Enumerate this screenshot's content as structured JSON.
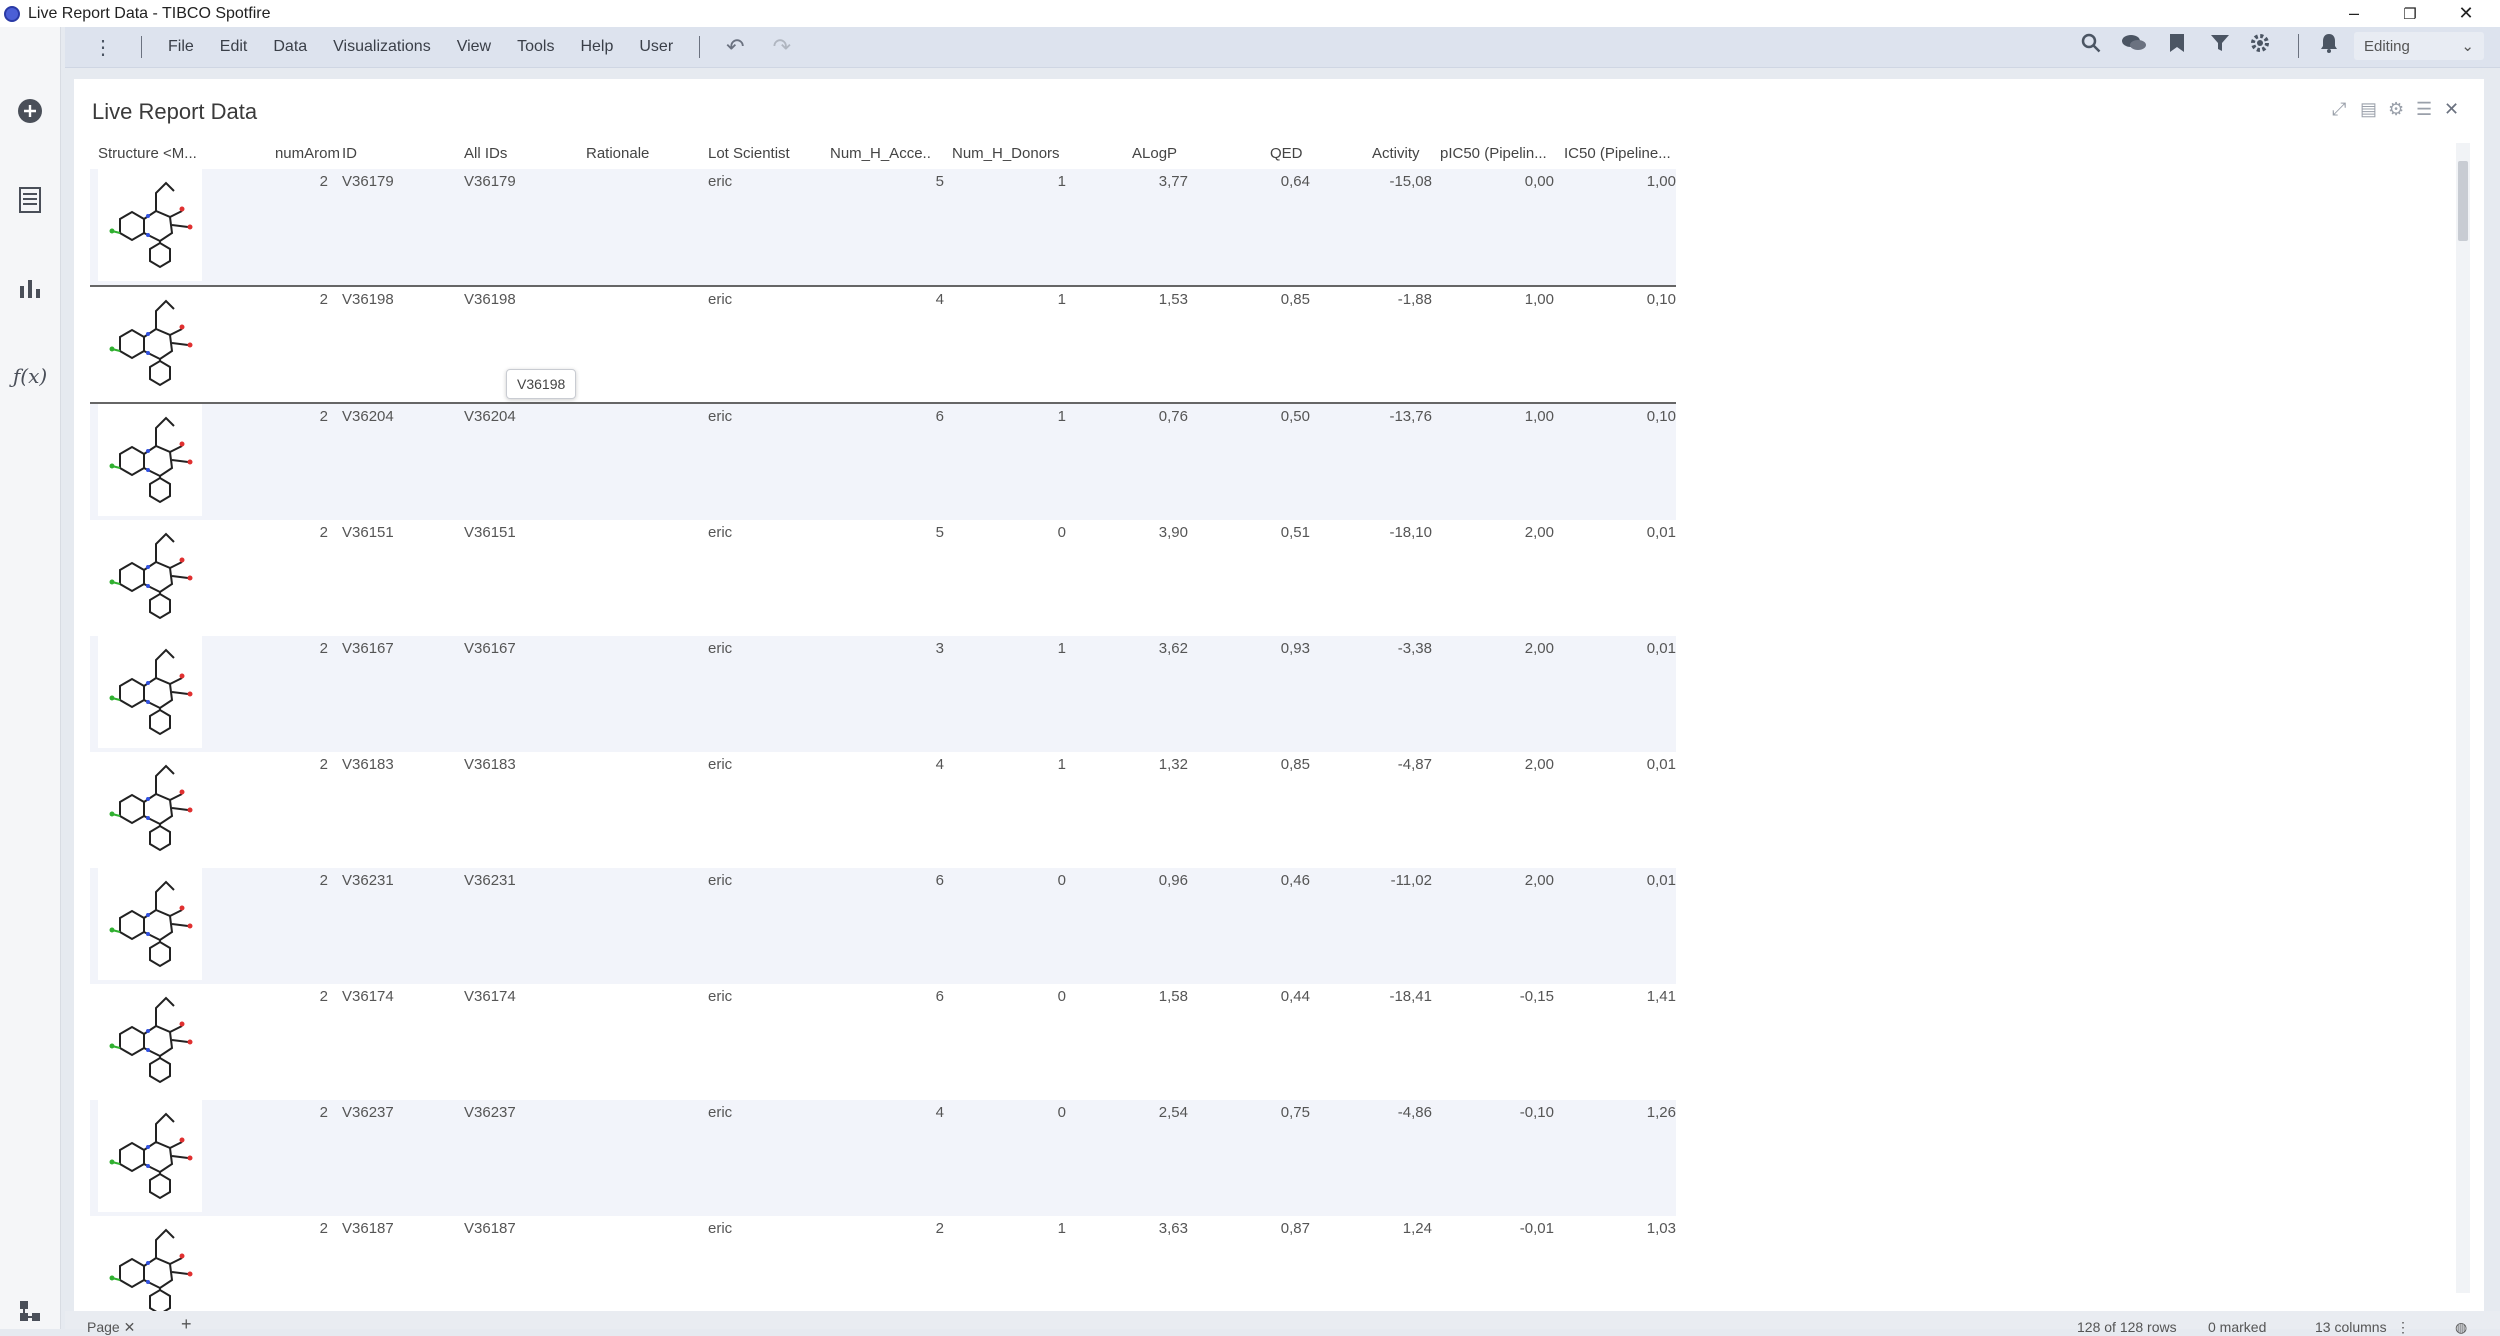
{
  "window": {
    "title": "Live Report Data - TIBCO Spotfire",
    "minimize": "–",
    "restore": "❐",
    "close": "✕"
  },
  "menubar": {
    "items": [
      "File",
      "Edit",
      "Data",
      "Visualizations",
      "View",
      "Tools",
      "Help",
      "User"
    ],
    "mode": "Editing"
  },
  "panel": {
    "title": "Live Report Data"
  },
  "table": {
    "columns": [
      "Structure <M...",
      "numArom",
      "ID",
      "All IDs",
      "Rationale",
      "Lot Scientist",
      "Num_H_Acce...",
      "Num_H_Donors",
      "ALogP",
      "QED",
      "Activity",
      "pIC50 (Pipelin...",
      "IC50 (Pipeline..."
    ],
    "rows": [
      {
        "numArom": "2",
        "id": "V36179",
        "all_ids": "V36179",
        "rationale": "",
        "lot_scientist": "eric",
        "acc": "5",
        "don": "1",
        "alogp": "3,77",
        "qed": "0,64",
        "activity": "-15,08",
        "pic50": "0,00",
        "ic50": "1,00"
      },
      {
        "numArom": "2",
        "id": "V36198",
        "all_ids": "V36198",
        "rationale": "",
        "lot_scientist": "eric",
        "acc": "4",
        "don": "1",
        "alogp": "1,53",
        "qed": "0,85",
        "activity": "-1,88",
        "pic50": "1,00",
        "ic50": "0,10"
      },
      {
        "numArom": "2",
        "id": "V36204",
        "all_ids": "V36204",
        "rationale": "",
        "lot_scientist": "eric",
        "acc": "6",
        "don": "1",
        "alogp": "0,76",
        "qed": "0,50",
        "activity": "-13,76",
        "pic50": "1,00",
        "ic50": "0,10"
      },
      {
        "numArom": "2",
        "id": "V36151",
        "all_ids": "V36151",
        "rationale": "",
        "lot_scientist": "eric",
        "acc": "5",
        "don": "0",
        "alogp": "3,90",
        "qed": "0,51",
        "activity": "-18,10",
        "pic50": "2,00",
        "ic50": "0,01"
      },
      {
        "numArom": "2",
        "id": "V36167",
        "all_ids": "V36167",
        "rationale": "",
        "lot_scientist": "eric",
        "acc": "3",
        "don": "1",
        "alogp": "3,62",
        "qed": "0,93",
        "activity": "-3,38",
        "pic50": "2,00",
        "ic50": "0,01"
      },
      {
        "numArom": "2",
        "id": "V36183",
        "all_ids": "V36183",
        "rationale": "",
        "lot_scientist": "eric",
        "acc": "4",
        "don": "1",
        "alogp": "1,32",
        "qed": "0,85",
        "activity": "-4,87",
        "pic50": "2,00",
        "ic50": "0,01"
      },
      {
        "numArom": "2",
        "id": "V36231",
        "all_ids": "V36231",
        "rationale": "",
        "lot_scientist": "eric",
        "acc": "6",
        "don": "0",
        "alogp": "0,96",
        "qed": "0,46",
        "activity": "-11,02",
        "pic50": "2,00",
        "ic50": "0,01"
      },
      {
        "numArom": "2",
        "id": "V36174",
        "all_ids": "V36174",
        "rationale": "",
        "lot_scientist": "eric",
        "acc": "6",
        "don": "0",
        "alogp": "1,58",
        "qed": "0,44",
        "activity": "-18,41",
        "pic50": "-0,15",
        "ic50": "1,41"
      },
      {
        "numArom": "2",
        "id": "V36237",
        "all_ids": "V36237",
        "rationale": "",
        "lot_scientist": "eric",
        "acc": "4",
        "don": "0",
        "alogp": "2,54",
        "qed": "0,75",
        "activity": "-4,86",
        "pic50": "-0,10",
        "ic50": "1,26"
      },
      {
        "numArom": "2",
        "id": "V36187",
        "all_ids": "V36187",
        "rationale": "",
        "lot_scientist": "eric",
        "acc": "2",
        "don": "1",
        "alogp": "3,63",
        "qed": "0,87",
        "activity": "1,24",
        "pic50": "-0,01",
        "ic50": "1,03"
      }
    ],
    "tooltip": "V36198"
  },
  "statusbar": {
    "page_tab": "Page",
    "rows": "128 of 128 rows",
    "marked": "0 marked",
    "columns": "13 columns"
  }
}
